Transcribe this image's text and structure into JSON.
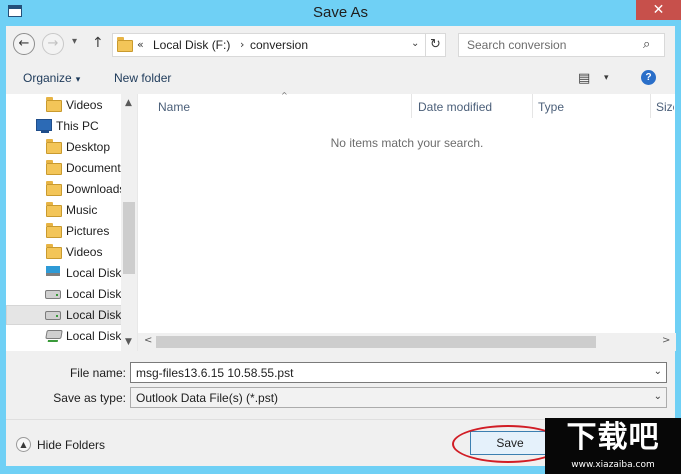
{
  "window": {
    "title": "Save As",
    "close_glyph": "✕"
  },
  "nav": {
    "back_glyph": "←",
    "forward_glyph": "→",
    "recent_glyph": "▾",
    "up_glyph": "↑"
  },
  "address": {
    "overflow": "«",
    "crumbs": [
      "Local Disk (F:)",
      "conversion"
    ],
    "separator": "›",
    "dropdown_glyph": "⌄",
    "refresh_glyph": "↻"
  },
  "search": {
    "placeholder": "Search conversion",
    "icon_glyph": "⌕"
  },
  "toolbar": {
    "organize_label": "Organize",
    "new_folder_label": "New folder",
    "caret": "▾",
    "view_glyph": "▤",
    "help_glyph": "?"
  },
  "tree": {
    "items": [
      {
        "label": "Videos",
        "icon": "folder-icon"
      },
      {
        "label": "This PC",
        "icon": "computer-icon"
      },
      {
        "label": "Desktop",
        "icon": "folder-icon"
      },
      {
        "label": "Documents",
        "icon": "folder-icon"
      },
      {
        "label": "Downloads",
        "icon": "folder-icon"
      },
      {
        "label": "Music",
        "icon": "folder-icon"
      },
      {
        "label": "Pictures",
        "icon": "folder-icon"
      },
      {
        "label": "Videos",
        "icon": "folder-icon"
      },
      {
        "label": "Local Disk",
        "icon": "windows-drive-icon"
      },
      {
        "label": "Local Disk",
        "icon": "drive-icon"
      },
      {
        "label": "Local Disk",
        "icon": "drive-icon"
      },
      {
        "label": "Local Disk",
        "icon": "network-drive-icon"
      }
    ],
    "selected_index": 10,
    "scroll_up": "▲",
    "scroll_down": "▼"
  },
  "columns": {
    "name": "Name",
    "date_modified": "Date modified",
    "type": "Type",
    "size": "Size",
    "sort_glyph": "^"
  },
  "list": {
    "empty_message": "No items match your search.",
    "scroll_left": "<",
    "scroll_right": ">"
  },
  "form": {
    "file_name_label": "File name:",
    "file_name_value": "msg-files13.6.15 10.58.55.pst",
    "save_type_label": "Save as type:",
    "save_type_value": "Outlook Data File(s) (*.pst)",
    "caret": "⌄"
  },
  "footer": {
    "hide_folders_label": "Hide Folders",
    "hide_folders_glyph": "▲",
    "save_label": "Save"
  },
  "watermark": {
    "logo": "下载吧",
    "url": "www.xiazaiba.com"
  },
  "colors": {
    "frame": "#6fd0f5",
    "close": "#c7504b",
    "client": "#f0f0f0",
    "highlight_ring": "#d11d25",
    "save_button": "#e5f1fb"
  }
}
